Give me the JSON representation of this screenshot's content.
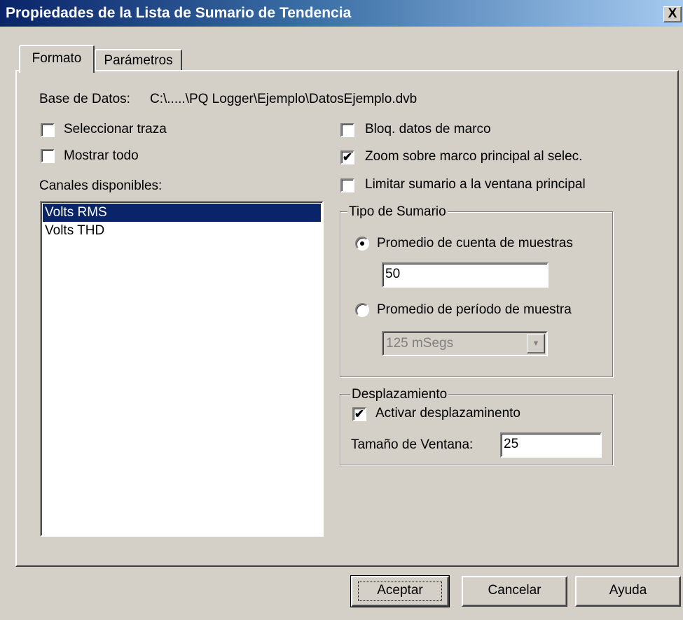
{
  "window": {
    "title": "Propiedades de la Lista de Sumario de Tendencia",
    "close_glyph": "X"
  },
  "tabs": [
    {
      "label": "Formato",
      "active": true
    },
    {
      "label": "Parámetros",
      "active": false
    }
  ],
  "database": {
    "label": "Base de Datos:",
    "path": "C:\\.....\\PQ Logger\\Ejemplo\\DatosEjemplo.dvb"
  },
  "left_options": {
    "select_trace": {
      "label": "Seleccionar traza",
      "checked": false
    },
    "show_all": {
      "label": "Mostrar todo",
      "checked": false
    }
  },
  "channels": {
    "label": "Canales disponibles:",
    "items": [
      {
        "label": "Volts RMS",
        "selected": true
      },
      {
        "label": "Volts THD",
        "selected": false
      }
    ]
  },
  "right_options": {
    "lock_frame": {
      "label": "Bloq. datos de marco",
      "checked": false
    },
    "zoom_main": {
      "label": "Zoom sobre marco principal al selec.",
      "checked": true
    },
    "limit_summary": {
      "label": "Limitar sumario a la ventana principal",
      "checked": false
    }
  },
  "summary_type": {
    "title": "Tipo de Sumario",
    "sample_count": {
      "label": "Promedio de cuenta de muestras",
      "selected": true,
      "value": "50"
    },
    "sample_period": {
      "label": "Promedio de período de muestra",
      "selected": false,
      "value": "125 mSegs"
    }
  },
  "scrolling": {
    "title": "Desplazamiento",
    "enable": {
      "label": "Activar desplazaminento",
      "checked": true
    },
    "window_size": {
      "label": "Tamaño de Ventana:",
      "value": "25"
    }
  },
  "buttons": {
    "accept": "Aceptar",
    "cancel": "Cancelar",
    "help": "Ayuda"
  },
  "glyphs": {
    "check": "✔",
    "dropdown": "▼"
  }
}
